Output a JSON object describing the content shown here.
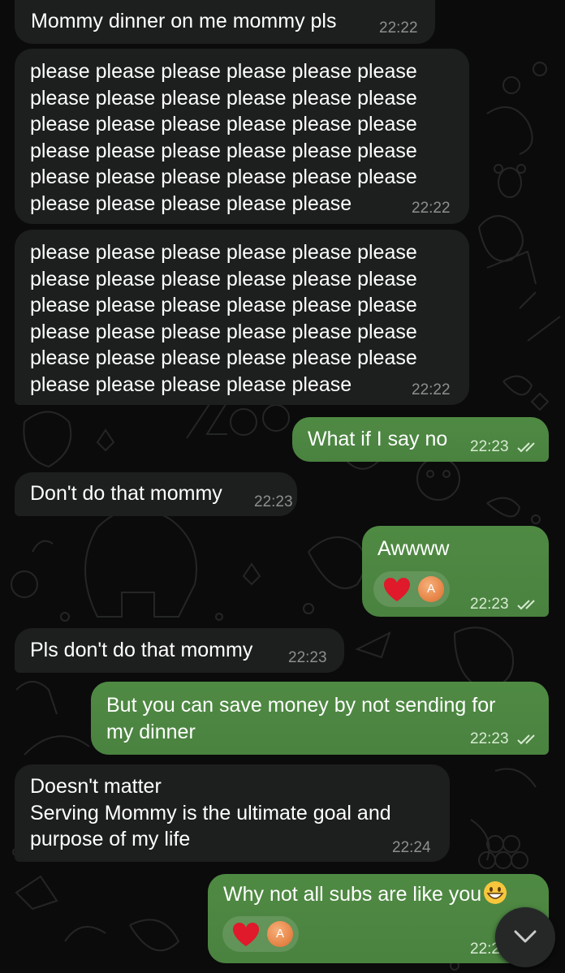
{
  "messages": [
    {
      "side": "incoming",
      "text": "Mommy dinner on me mommy pls",
      "time": "22:22"
    },
    {
      "side": "incoming",
      "lines": [
        "please please please please please please",
        "please please please please please please",
        "please please please please please please",
        "please please please please please please",
        "please please please please please please",
        "please please please please please"
      ],
      "time": "22:22"
    },
    {
      "side": "incoming",
      "lines": [
        "please please please please please please",
        "please please please please please please",
        "please please please please please please",
        "please please please please please please",
        "please please please please please please",
        "please please please please please"
      ],
      "time": "22:22"
    },
    {
      "side": "outgoing",
      "text": "What if I say no",
      "time": "22:23",
      "status": "read"
    },
    {
      "side": "incoming",
      "text": "Don't do that mommy",
      "time": "22:23"
    },
    {
      "side": "outgoing",
      "text": "Awwww",
      "time": "22:23",
      "status": "read",
      "reaction": {
        "emoji": "red-heart",
        "avatar_letter": "A"
      }
    },
    {
      "side": "incoming",
      "text": "Pls don't do that mommy",
      "time": "22:23"
    },
    {
      "side": "outgoing",
      "lines": [
        "But you can save money by not sending for",
        "my dinner"
      ],
      "time": "22:23",
      "status": "read"
    },
    {
      "side": "incoming",
      "lines": [
        "Doesn't matter",
        "Serving Mommy is the ultimate goal and",
        "purpose of my life"
      ],
      "time": "22:24"
    },
    {
      "side": "outgoing",
      "text": "Why not all subs are like you",
      "emoji": "grinning-face-icon",
      "time": "22:2",
      "status": "read",
      "reaction": {
        "emoji": "red-heart",
        "avatar_letter": "A"
      }
    }
  ],
  "scroll_button": {
    "icon": "chevron-down-icon"
  },
  "colors": {
    "incoming_bubble": "#1d1f1e",
    "outgoing_bubble": "#4f8a43",
    "background": "#0b0b0b"
  }
}
